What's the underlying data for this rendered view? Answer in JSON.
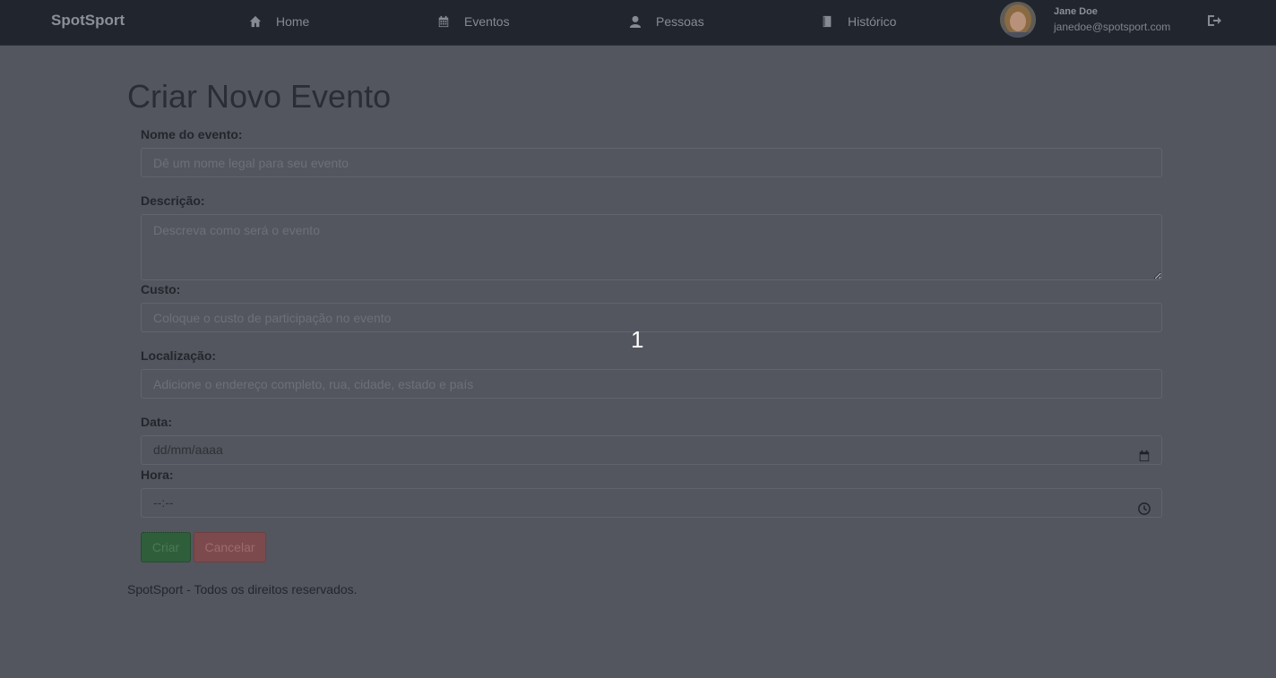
{
  "navbar": {
    "brand": "SpotSport",
    "items": [
      {
        "label": "Home",
        "icon": "home-icon"
      },
      {
        "label": "Eventos",
        "icon": "calendar-icon"
      },
      {
        "label": "Pessoas",
        "icon": "user-icon"
      },
      {
        "label": "Histórico",
        "icon": "book-icon"
      }
    ],
    "user": {
      "name": "Jane Doe",
      "email": "janedoe@spotsport.com",
      "logout_icon": "logout-icon"
    }
  },
  "form": {
    "title": "Criar Novo Evento",
    "name_label": "Nome do evento:",
    "name_placeholder": "Dê um nome legal para seu evento",
    "description_label": "Descrição:",
    "description_placeholder": "Descreva como será o evento",
    "cost_label": "Custo:",
    "cost_placeholder": "Coloque o custo de participação no evento",
    "location_label": "Localização:",
    "location_placeholder": "Adicione o endereço completo, rua, cidade, estado e país",
    "date_label": "Data:",
    "date_value": "dd/mm/aaaa",
    "time_label": "Hora:",
    "time_value": "--:--",
    "create_button": "Criar",
    "cancel_button": "Cancelar"
  },
  "footer": {
    "text": "SpotSport - Todos os direitos reservados."
  },
  "overlay": {
    "number": "1"
  },
  "colors": {
    "navbar_bg": "#21252d",
    "page_bg": "#53565f",
    "create_button": "#2f5e3a",
    "cancel_button": "#7c4a4d"
  }
}
